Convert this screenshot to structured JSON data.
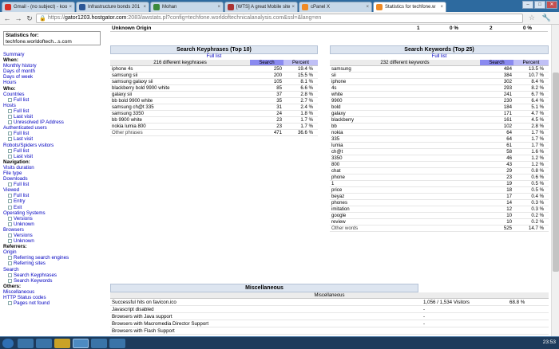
{
  "tabs": [
    {
      "label": "Gmail - (no subject) - koo",
      "icon": "gmail-icon",
      "color": "#d93025"
    },
    {
      "label": "Infrastructure bonds 201",
      "icon": "page-icon",
      "color": "#2b5797"
    },
    {
      "label": "Mohan",
      "icon": "facebook-icon",
      "color": "#3b8a3b"
    },
    {
      "label": "[WTS] A great Mobile site",
      "icon": "page-icon",
      "color": "#a33"
    },
    {
      "label": "cPanel X",
      "icon": "cpanel-icon",
      "color": "#f08a24"
    },
    {
      "label": "Statistics for techfone.w",
      "icon": "cpanel-icon",
      "color": "#f08a24"
    }
  ],
  "url": {
    "scheme": "https://",
    "host": "gator1203.hostgator.com",
    "rest": ":2083/awstats.pl?config=techfone.worldoftechnicalanalysis.com&ssl=&lang=en"
  },
  "sidebar": {
    "stats_for_label": "Statistics for:",
    "stats_for_value": "techfone.worldoftech...s.com",
    "items": [
      {
        "t": "Summary",
        "c": "l1"
      },
      {
        "t": "When:",
        "c": "h"
      },
      {
        "t": "Monthly history",
        "c": "l1"
      },
      {
        "t": "Days of month",
        "c": "l1"
      },
      {
        "t": "Days of week",
        "c": "l1"
      },
      {
        "t": "Hours",
        "c": "l1"
      },
      {
        "t": "Who:",
        "c": "h"
      },
      {
        "t": "Countries",
        "c": "l1"
      },
      {
        "t": "Full list",
        "c": "l2"
      },
      {
        "t": "Hosts",
        "c": "l1"
      },
      {
        "t": "Full list",
        "c": "l2"
      },
      {
        "t": "Last visit",
        "c": "l2"
      },
      {
        "t": "Unresolved IP Address",
        "c": "l2"
      },
      {
        "t": "Authenticated users",
        "c": "l1"
      },
      {
        "t": "Full list",
        "c": "l2"
      },
      {
        "t": "Last visit",
        "c": "l2"
      },
      {
        "t": "Robots/Spiders visitors",
        "c": "l1"
      },
      {
        "t": "Full list",
        "c": "l2"
      },
      {
        "t": "Last visit",
        "c": "l2"
      },
      {
        "t": "Navigation:",
        "c": "h"
      },
      {
        "t": "Visits duration",
        "c": "l1"
      },
      {
        "t": "File type",
        "c": "l1"
      },
      {
        "t": "Downloads",
        "c": "l1"
      },
      {
        "t": "Full list",
        "c": "l2"
      },
      {
        "t": "Viewed",
        "c": "l1"
      },
      {
        "t": "Full list",
        "c": "l2"
      },
      {
        "t": "Entry",
        "c": "l2"
      },
      {
        "t": "Exit",
        "c": "l2"
      },
      {
        "t": "Operating Systems",
        "c": "l1"
      },
      {
        "t": "Versions",
        "c": "l2"
      },
      {
        "t": "Unknown",
        "c": "l2"
      },
      {
        "t": "Browsers",
        "c": "l1"
      },
      {
        "t": "Versions",
        "c": "l2"
      },
      {
        "t": "Unknown",
        "c": "l2"
      },
      {
        "t": "Referrers:",
        "c": "h"
      },
      {
        "t": "Origin",
        "c": "l1"
      },
      {
        "t": "Referring search engines",
        "c": "l2"
      },
      {
        "t": "Referring sites",
        "c": "l2"
      },
      {
        "t": "Search",
        "c": "l1"
      },
      {
        "t": "Search Keyphrases",
        "c": "l2"
      },
      {
        "t": "Search Keywords",
        "c": "l2"
      },
      {
        "t": "Others:",
        "c": "h"
      },
      {
        "t": "Miscellaneous",
        "c": "l1"
      },
      {
        "t": "HTTP Status codes",
        "c": "l1"
      },
      {
        "t": "Pages not found",
        "c": "l2"
      }
    ]
  },
  "topline": {
    "label": "Unknown Origin",
    "v1": "1",
    "v2": "0 %",
    "v3": "2",
    "v4": "0 %"
  },
  "keyphrases": {
    "title": "Search Keyphrases (Top 10)",
    "full_list": "Full list",
    "count_label": "216 different keyphrases",
    "col_search": "Search",
    "col_percent": "Percent",
    "rows": [
      [
        "iphone 4s",
        "250",
        "19.4 %"
      ],
      [
        "samsung sii",
        "200",
        "15.5 %"
      ],
      [
        "samsung galaxy sii",
        "105",
        "8.1 %"
      ],
      [
        "blackberry bold 9900 white",
        "85",
        "6.6 %"
      ],
      [
        "galaxy sii",
        "37",
        "2.8 %"
      ],
      [
        "bb bold 9900 white",
        "35",
        "2.7 %"
      ],
      [
        "samsung ch@t 335",
        "31",
        "2.4 %"
      ],
      [
        "samsung 3350",
        "24",
        "1.8 %"
      ],
      [
        "bb 9900 white",
        "23",
        "1.7 %"
      ],
      [
        "nokia lumia 800",
        "23",
        "1.7 %"
      ]
    ],
    "other": [
      "Other phrases",
      "471",
      "36.6 %"
    ]
  },
  "keywords": {
    "title": "Search Keywords (Top 25)",
    "full_list": "Full list",
    "count_label": "232 different keywords",
    "col_search": "Search",
    "col_percent": "Percent",
    "rows": [
      [
        "samsung",
        "484",
        "13.5 %"
      ],
      [
        "sii",
        "384",
        "10.7 %"
      ],
      [
        "iphone",
        "302",
        "8.4 %"
      ],
      [
        "4s",
        "293",
        "8.2 %"
      ],
      [
        "white",
        "241",
        "6.7 %"
      ],
      [
        "9900",
        "230",
        "6.4 %"
      ],
      [
        "bold",
        "184",
        "5.1 %"
      ],
      [
        "galaxy",
        "171",
        "4.7 %"
      ],
      [
        "blackberry",
        "161",
        "4.5 %"
      ],
      [
        "bb",
        "102",
        "2.8 %"
      ],
      [
        "nokia",
        "64",
        "1.7 %"
      ],
      [
        "335",
        "64",
        "1.7 %"
      ],
      [
        "lumia",
        "61",
        "1.7 %"
      ],
      [
        "ch@t",
        "58",
        "1.6 %"
      ],
      [
        "3350",
        "46",
        "1.2 %"
      ],
      [
        "800",
        "43",
        "1.2 %"
      ],
      [
        "chat",
        "29",
        "0.8 %"
      ],
      [
        "phone",
        "23",
        "0.6 %"
      ],
      [
        "1",
        "19",
        "0.5 %"
      ],
      [
        "price",
        "18",
        "0.5 %"
      ],
      [
        "beyaz",
        "17",
        "0.4 %"
      ],
      [
        "phones",
        "14",
        "0.3 %"
      ],
      [
        "imitation",
        "12",
        "0.3 %"
      ],
      [
        "google",
        "10",
        "0.2 %"
      ],
      [
        "review",
        "10",
        "0.2 %"
      ]
    ],
    "other": [
      "Other words",
      "525",
      "14.7 %"
    ]
  },
  "misc": {
    "title": "Miscellaneous",
    "header": "Miscellaneous",
    "rows": [
      [
        "Successful hits on favicon.ico",
        "1,056 / 1,534 Visitors",
        "68.8 %"
      ],
      [
        "Javascript disabled",
        "-",
        ""
      ],
      [
        "Browsers with Java support",
        "-",
        ""
      ],
      [
        "Browsers with Macromedia Director Support",
        "-",
        ""
      ],
      [
        "Browsers with Flash Support",
        "",
        ""
      ]
    ]
  },
  "clock": "23:53"
}
